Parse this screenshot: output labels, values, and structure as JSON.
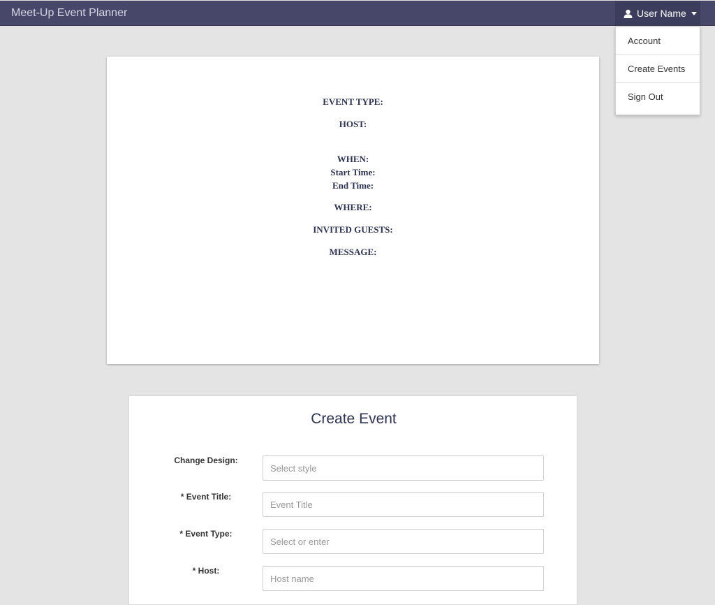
{
  "app": {
    "title": "Meet-Up Event Planner"
  },
  "user_menu": {
    "label": "User Name",
    "items": [
      "Account",
      "Create Events",
      "Sign Out"
    ]
  },
  "preview": {
    "event_type": "EVENT TYPE:",
    "host": "HOST:",
    "when": "WHEN:",
    "start_time": "Start Time:",
    "end_time": "End Time:",
    "where": "WHERE:",
    "invited_guests": "INVITED GUESTS:",
    "message": "MESSAGE:"
  },
  "form": {
    "title": "Create Event",
    "fields": [
      {
        "label": "Change Design:",
        "placeholder": "Select style"
      },
      {
        "label": "* Event Title:",
        "placeholder": "Event Title"
      },
      {
        "label": "* Event Type:",
        "placeholder": "Select or enter"
      },
      {
        "label": "* Host:",
        "placeholder": "Host name"
      }
    ]
  },
  "colors": {
    "navbar": "#47476a",
    "user_toggle": "#3c3c5c",
    "page_bg": "#e4e4e4",
    "heading_text": "#2e3350"
  },
  "icons": {
    "user": "user-icon",
    "caret": "caret-down-icon"
  }
}
